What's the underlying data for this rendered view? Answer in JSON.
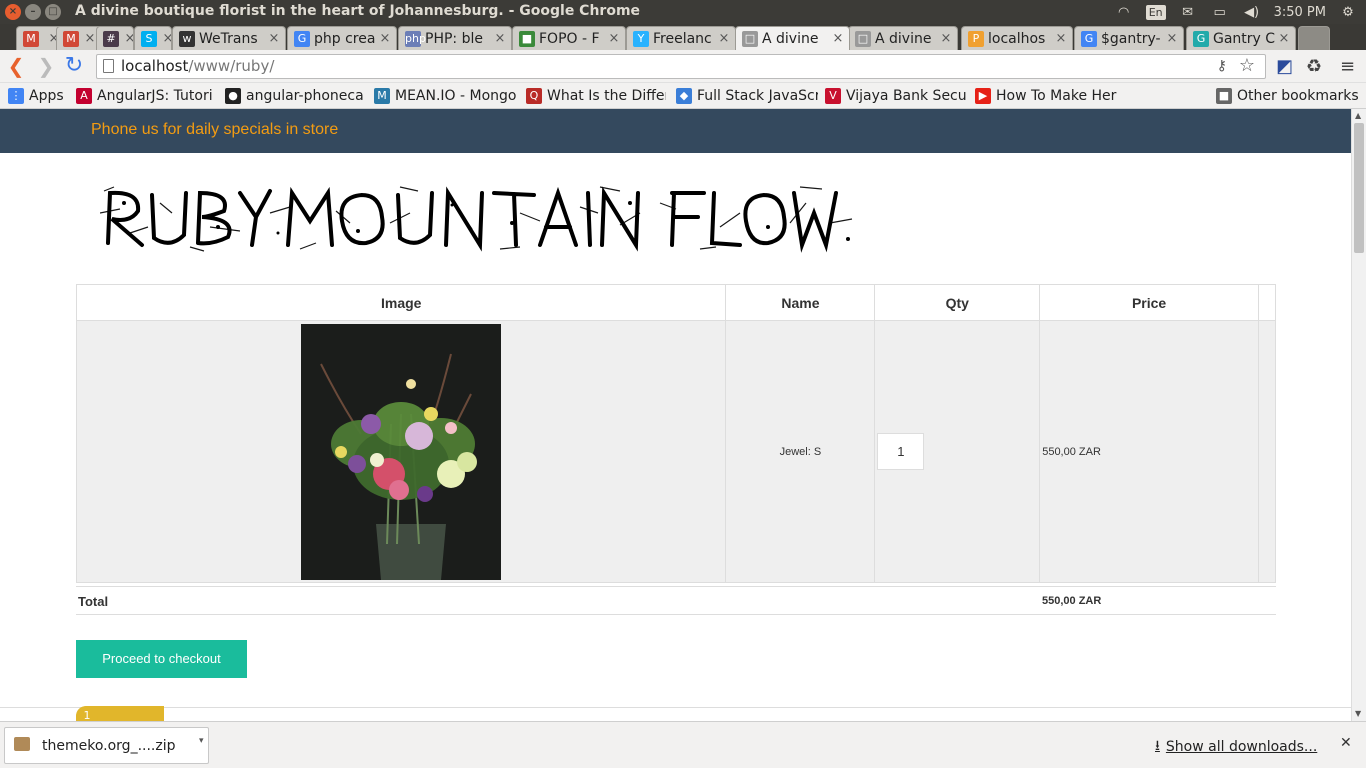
{
  "window": {
    "title": "A divine boutique florist in the heart of Johannesburg. - Google Chrome"
  },
  "systray": {
    "lang": "En",
    "time": "3:50 PM"
  },
  "tabs": [
    {
      "label": "",
      "color": "#d14836",
      "ico": "M"
    },
    {
      "label": "",
      "color": "#d14836",
      "ico": "M"
    },
    {
      "label": "",
      "color": "#4a3a4a",
      "ico": "#"
    },
    {
      "label": "",
      "color": "#00aff0",
      "ico": "S"
    },
    {
      "label": "WeTrans",
      "color": "#333",
      "ico": "w"
    },
    {
      "label": "php crea",
      "color": "#4285f4",
      "ico": "G"
    },
    {
      "label": "PHP: ble",
      "color": "#6c7eb7",
      "ico": "php"
    },
    {
      "label": "FOPO - F",
      "color": "#3a8a3a",
      "ico": "■"
    },
    {
      "label": "Freelanc",
      "color": "#29b2fe",
      "ico": "Y"
    },
    {
      "label": "A divine",
      "color": "#999",
      "ico": "□"
    },
    {
      "label": "A divine",
      "color": "#999",
      "ico": "□"
    },
    {
      "label": "localhos",
      "color": "#f0a030",
      "ico": "P"
    },
    {
      "label": "$gantry-",
      "color": "#4285f4",
      "ico": "G"
    },
    {
      "label": "Gantry C",
      "color": "#2aa",
      "ico": "G"
    }
  ],
  "address": {
    "host": "localhost",
    "path": "/www/ruby/"
  },
  "bookmarks": [
    {
      "label": "Apps",
      "color": "#4285f4",
      "ico": "⋮"
    },
    {
      "label": "AngularJS: Tutori",
      "color": "#c3002f",
      "ico": "A"
    },
    {
      "label": "angular-phoneca",
      "color": "#222",
      "ico": "●"
    },
    {
      "label": "MEAN.IO - Mongo",
      "color": "#2a7aa8",
      "ico": "M"
    },
    {
      "label": "What Is the Differ",
      "color": "#b92b27",
      "ico": "Q"
    },
    {
      "label": "Full Stack JavaScr",
      "color": "#3a7ed8",
      "ico": "◆"
    },
    {
      "label": "Vijaya Bank Secu",
      "color": "#c8102e",
      "ico": "V"
    },
    {
      "label": "How To Make Her",
      "color": "#e62117",
      "ico": "▶"
    },
    {
      "label": "Other bookmarks",
      "color": "#666",
      "ico": "■"
    }
  ],
  "page": {
    "topbar_text": "Phone us for daily specials in store",
    "logo_alt": "RUBY MOUNTAIN FLOWERS",
    "cart": {
      "headers": {
        "image": "Image",
        "name": "Name",
        "qty": "Qty",
        "price": "Price"
      },
      "rows": [
        {
          "name": "Jewel: S",
          "qty": "1",
          "price": "550,00 ZAR"
        }
      ],
      "total_label": "Total",
      "total_value": "550,00 ZAR"
    },
    "checkout_label": "Proceed to checkout",
    "badge_count": "1"
  },
  "downloads": {
    "file": "themeko.org_....zip",
    "show_all": "Show all downloads..."
  }
}
